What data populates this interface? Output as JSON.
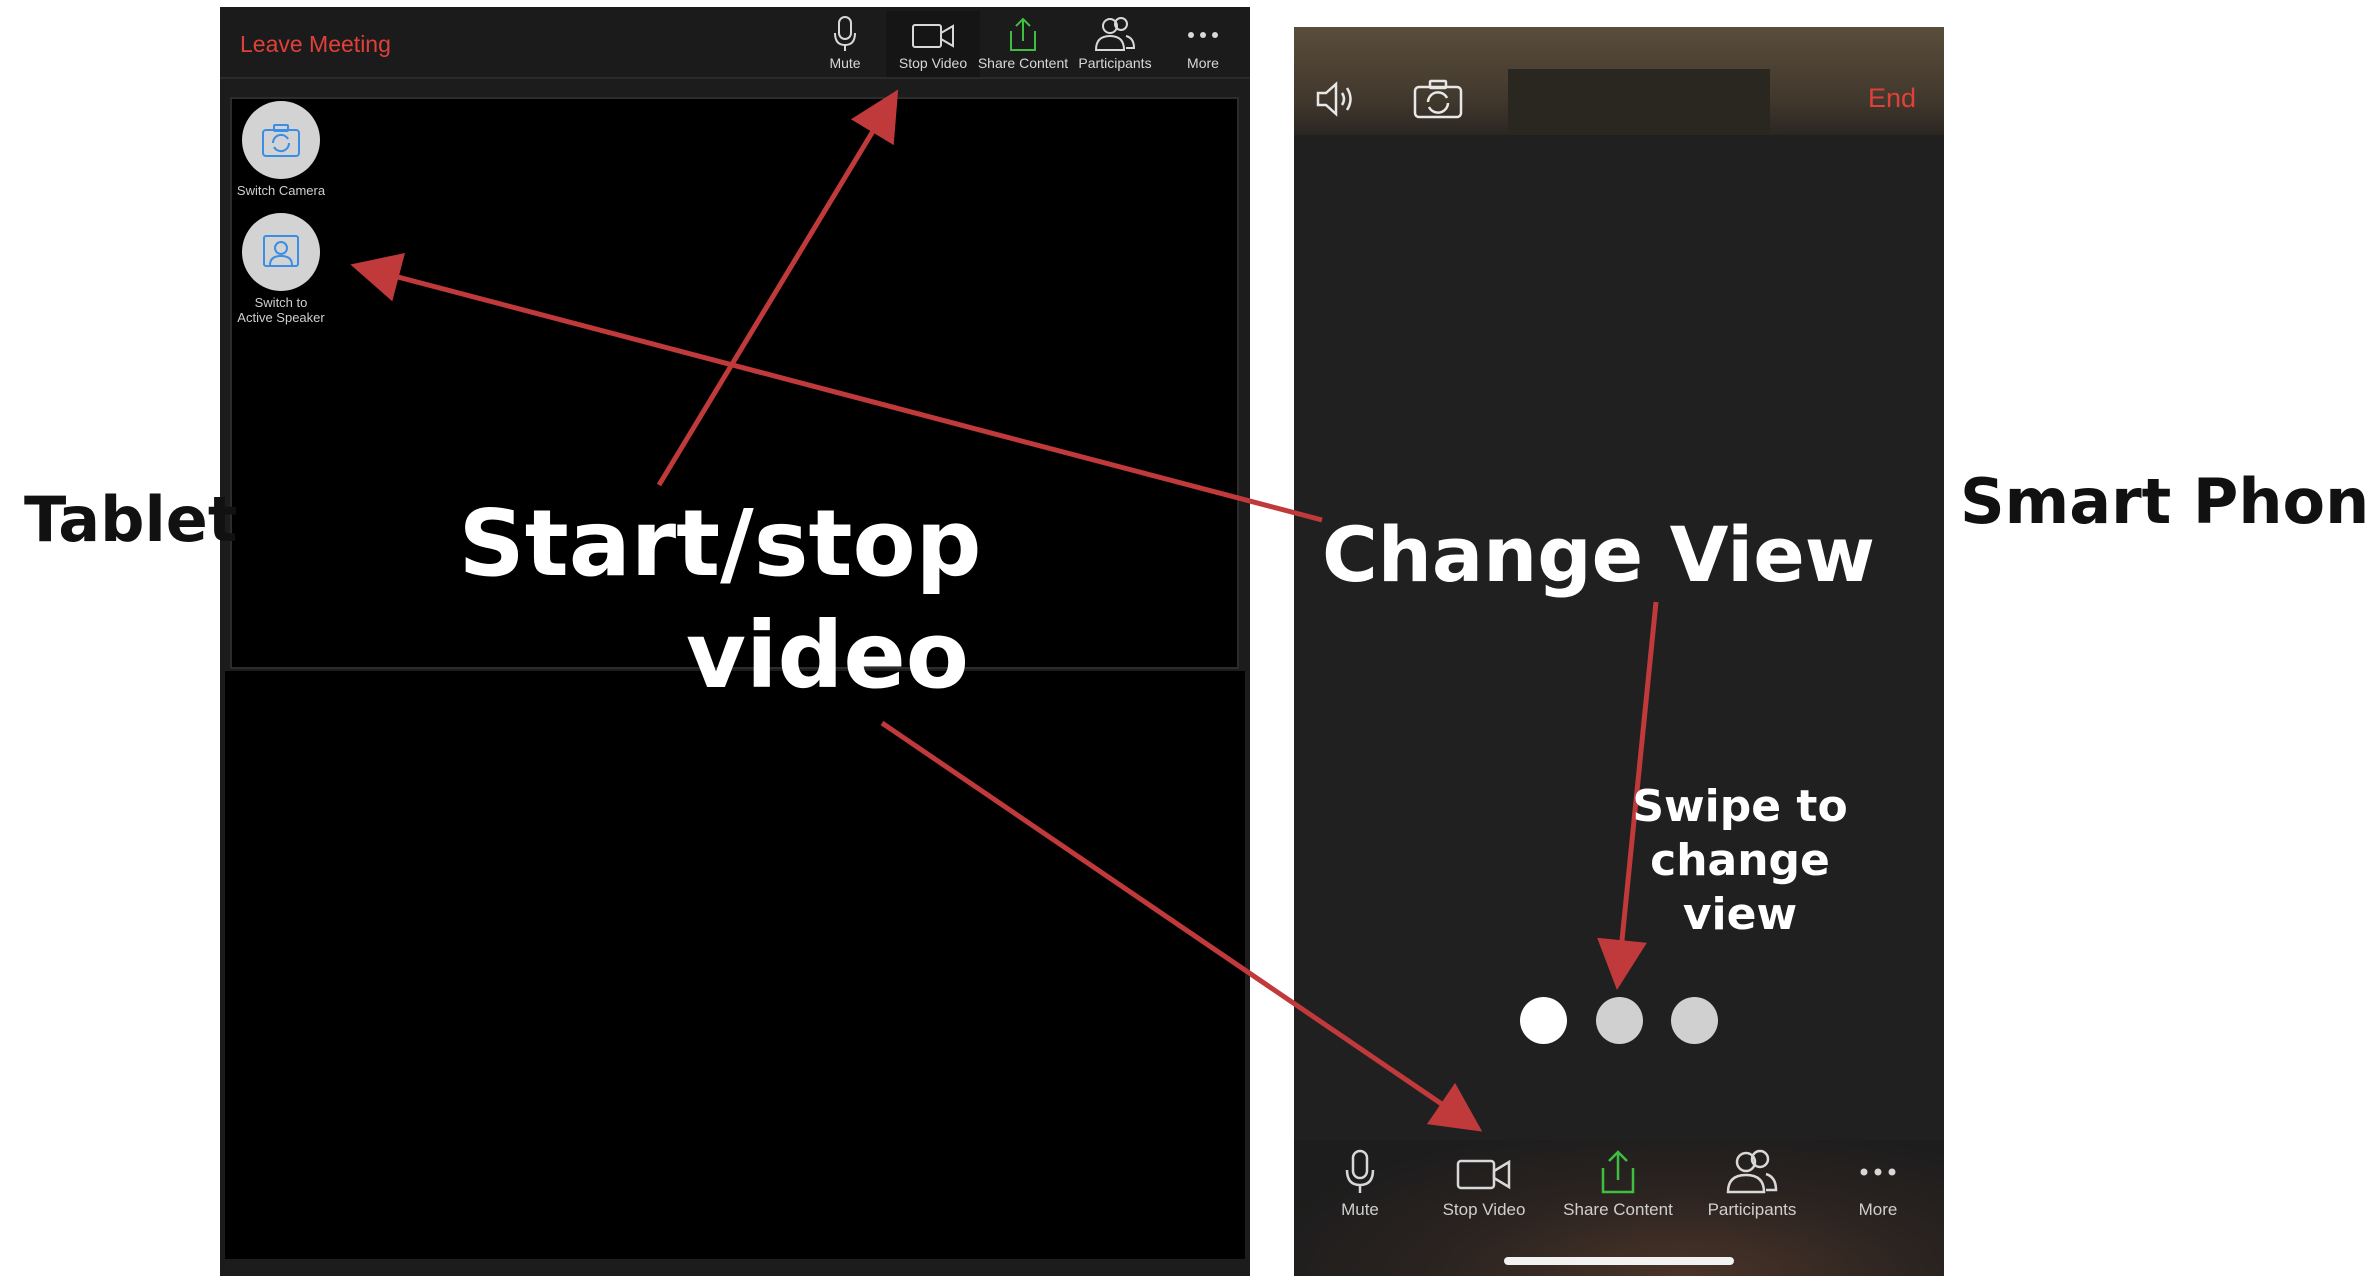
{
  "tablet": {
    "leave_label": "Leave Meeting",
    "toolbar": [
      {
        "label": "Mute",
        "icon": "microphone-icon"
      },
      {
        "label": "Stop Video",
        "icon": "video-camera-icon"
      },
      {
        "label": "Share Content",
        "icon": "share-upload-icon"
      },
      {
        "label": "Participants",
        "icon": "participants-icon"
      },
      {
        "label": "More",
        "icon": "more-dots-icon"
      }
    ],
    "side_buttons": [
      {
        "label": "Switch Camera",
        "icon": "switch-camera-icon"
      },
      {
        "label": "Switch to\nActive Speaker",
        "icon": "active-speaker-icon"
      }
    ]
  },
  "phone": {
    "end_label": "End",
    "toolbar": [
      {
        "label": "Mute",
        "icon": "microphone-icon"
      },
      {
        "label": "Stop Video",
        "icon": "video-camera-icon"
      },
      {
        "label": "Share Content",
        "icon": "share-upload-icon"
      },
      {
        "label": "Participants",
        "icon": "participants-icon"
      },
      {
        "label": "More",
        "icon": "more-dots-icon"
      }
    ],
    "page_indicator": {
      "count": 3,
      "active": 1
    }
  },
  "callouts": {
    "tablet": "Tablet",
    "smart_phone": "Smart Phone",
    "start_stop_line1": "Start/stop",
    "start_stop_line2": "video",
    "change_view": "Change View",
    "swipe_line1": "Swipe to",
    "swipe_line2": "change",
    "swipe_line3": "view"
  },
  "colors": {
    "accent_red": "#e0403a",
    "share_green": "#3fbf3f",
    "arrow_red": "#c0393b"
  }
}
